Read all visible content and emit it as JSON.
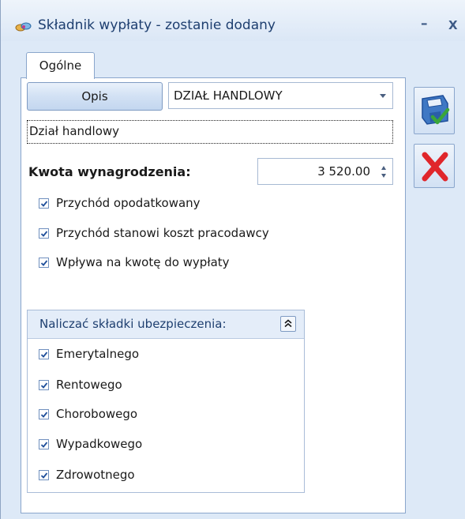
{
  "window": {
    "title": "Składnik wypłaty - zostanie dodany",
    "minimize_symbol": "–",
    "close_symbol": "X"
  },
  "tabs": [
    {
      "label": "Ogólne",
      "active": true
    }
  ],
  "form": {
    "opis_button_label": "Opis",
    "department_selected": "DZIAŁ HANDLOWY",
    "description_value": "Dział handlowy",
    "amount_label": "Kwota wynagrodzenia:",
    "amount_value": "3 520.00",
    "checkboxes": [
      {
        "label": "Przychód opodatkowany",
        "checked": true
      },
      {
        "label": "Przychód stanowi koszt pracodawcy",
        "checked": true
      },
      {
        "label": "Wpływa na kwotę do wypłaty",
        "checked": true
      }
    ]
  },
  "insurance_group": {
    "title": "Naliczać składki ubezpieczenia:",
    "items": [
      {
        "label": "Emerytalnego",
        "checked": true
      },
      {
        "label": "Rentowego",
        "checked": true
      },
      {
        "label": "Chorobowego",
        "checked": true
      },
      {
        "label": "Wypadkowego",
        "checked": true
      },
      {
        "label": "Zdrowotnego",
        "checked": true
      }
    ]
  },
  "side_buttons": {
    "save_icon": "save-disk-check-icon",
    "cancel_icon": "red-x-icon"
  },
  "colors": {
    "window_bg": "#dde9f7",
    "title_text": "#1e3f70",
    "check_mark": "#1f4f9a",
    "cancel_red": "#e0262b",
    "save_green": "#3aa63a"
  }
}
